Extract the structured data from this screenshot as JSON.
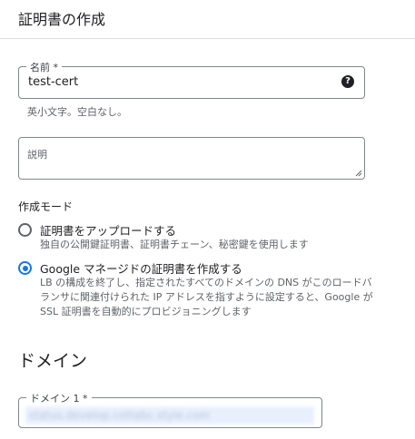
{
  "title": "証明書の作成",
  "name_field": {
    "label": "名前 *",
    "value": "test-cert",
    "help_icon": "?",
    "hint": "英小文字。空白なし。"
  },
  "description_field": {
    "placeholder": "説明"
  },
  "mode": {
    "label": "作成モード",
    "options": [
      {
        "label": "証明書をアップロードする",
        "description": "独自の公開鍵証明書、証明書チェーン、秘密鍵を使用します",
        "checked": false
      },
      {
        "label": "Google マネージドの証明書を作成する",
        "description": "LB の構成を終了し、指定されたすべてのドメインの DNS がこのロードバランサに関連付けられた IP アドレスを指すように設定すると、Google が SSL 証明書を自動的にプロビジョニングします",
        "checked": true
      }
    ]
  },
  "domains": {
    "heading": "ドメイン",
    "field_label": "ドメイン 1 *",
    "value": "status.develop.cottabc.style.com"
  },
  "colors": {
    "accent": "#1a73e8",
    "border": "#80868b",
    "hint_text": "#5f6368"
  }
}
